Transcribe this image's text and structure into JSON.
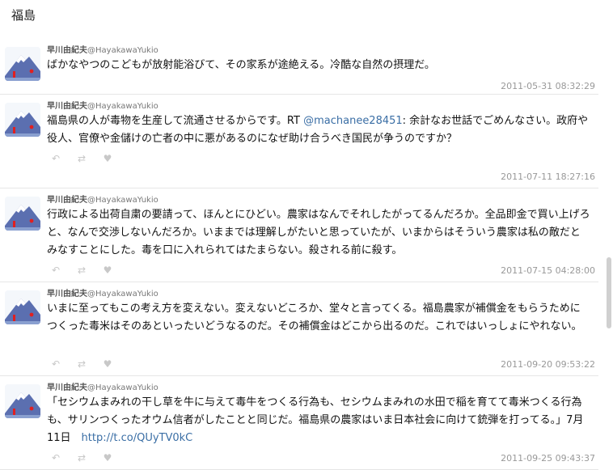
{
  "page": {
    "title": "福島"
  },
  "tweets": [
    {
      "name": "早川由紀夫",
      "handle": "@HayakawaYukio",
      "text_before": "ばかなやつのこどもが放射能浴びて、その家系が途絶える。冷酷な自然の摂理だ。",
      "link": "",
      "text_after": "",
      "timestamp": "2011-05-31 08:32:29"
    },
    {
      "name": "早川由紀夫",
      "handle": "@HayakawaYukio",
      "text_before": "福島県の人が毒物を生産して流通させるからです。RT ",
      "link": "@machanee28451",
      "text_after": ": 余計なお世話でごめんなさい。政府や役人、官僚や金儲けの亡者の中に悪があるのになぜ助け合うべき国民が争うのですか？",
      "timestamp": "2011-07-11 18:27:16"
    },
    {
      "name": "早川由紀夫",
      "handle": "@HayakawaYukio",
      "text_before": "行政による出荷自粛の要請って、ほんとにひどい。農家はなんでそれしたがってるんだろか。全品即金で買い上げろと、なんで交渉しないんだろか。いままでは理解しがたいと思っていたが、いまからはそういう農家は私の敵だとみなすことにした。毒を口に入れられてはたまらない。殺される前に殺す。",
      "link": "",
      "text_after": "",
      "timestamp": "2011-07-15 04:28:00"
    },
    {
      "name": "早川由紀夫",
      "handle": "@HayakawaYukio",
      "text_before": "いまに至ってもこの考え方を変えない。変えないどころか、堂々と言ってくる。福島農家が補償金をもらうためにつくった毒米はそのあといったいどうなるのだ。その補償金はどこから出るのだ。これではいっしょにやれない。",
      "link": "",
      "text_after": "",
      "timestamp": "2011-09-20 09:53:22"
    },
    {
      "name": "早川由紀夫",
      "handle": "@HayakawaYukio",
      "text_before": "「セシウムまみれの干し草を牛に与えて毒牛をつくる行為も、セシウムまみれの水田で稲を育てて毒米つくる行為も、サリンつくったオウム信者がしたことと同じだ。福島県の農家はいま日本社会に向けて銃弾を打ってる。」7月11日　",
      "link": "http://t.co/QUyTV0kC",
      "text_after": "",
      "timestamp": "2011-09-25 09:43:37"
    }
  ],
  "icons": {
    "reply": "reply-icon",
    "retweet": "retweet-icon",
    "favorite": "heart-icon",
    "avatar": "mountain-avatar-icon"
  },
  "colors": {
    "link": "#3a6ea5",
    "timestamp": "#999999",
    "avatar_mountain": "#5b6fb0",
    "avatar_snow": "#ffffff",
    "avatar_red": "#e02020"
  }
}
